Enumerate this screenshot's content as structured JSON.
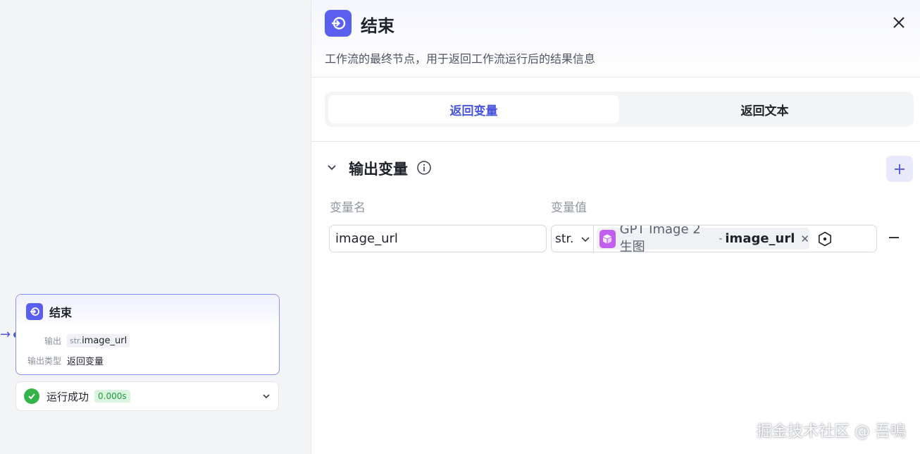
{
  "canvas": {
    "node": {
      "title": "结束",
      "output_label": "输出",
      "output_prefix": "str.",
      "output_value": "image_url",
      "output_type_label": "输出类型",
      "output_type_value": "返回变量"
    },
    "run": {
      "label": "运行成功",
      "time": "0.000s"
    }
  },
  "panel": {
    "title": "结束",
    "description": "工作流的最终节点，用于返回工作流运行后的结果信息",
    "tabs": [
      {
        "label": "返回变量",
        "active": true
      },
      {
        "label": "返回文本",
        "active": false
      }
    ],
    "section_title": "输出变量",
    "columns": {
      "name": "变量名",
      "value": "变量值"
    },
    "row": {
      "name_value": "image_url",
      "type": "str.",
      "ref_node": "GPT Image 2 生图",
      "ref_sep": "-",
      "ref_var": "image_url"
    }
  },
  "watermark": "掘金技术社区 @ 吾鳴",
  "colors": {
    "accent": "#5b5ff0",
    "success": "#34b34a",
    "cube": "#c160ef"
  }
}
